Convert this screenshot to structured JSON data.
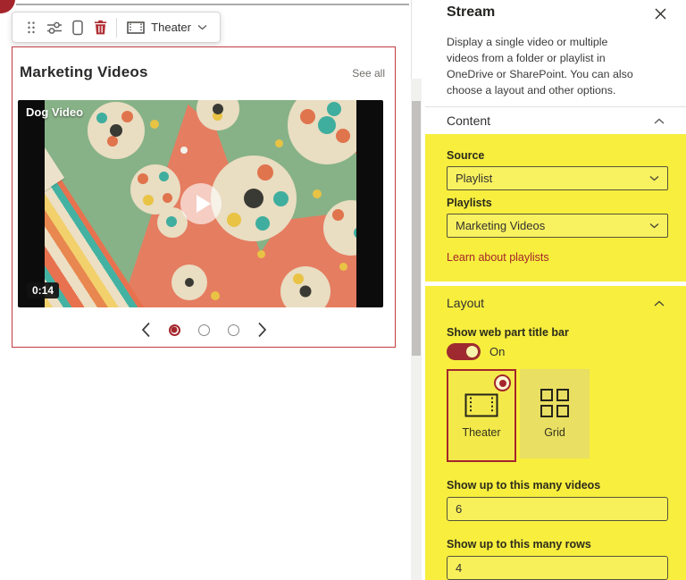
{
  "canvas": {
    "toolbar": {
      "layout_button_label": "Theater",
      "icons": [
        "drag-handle-icon",
        "edit-properties-icon",
        "duplicate-icon",
        "delete-icon",
        "theater-layout-icon",
        "chevron-down-icon"
      ]
    },
    "webpart": {
      "title": "Marketing Videos",
      "see_all": "See all",
      "video": {
        "title_overlay": "Dog Video",
        "duration": "0:14",
        "play_icon": "play-icon"
      },
      "carousel": {
        "dot_count": 3,
        "selected_index": 0,
        "prev_icon": "chevron-left-icon",
        "next_icon": "chevron-right-icon"
      }
    }
  },
  "panel": {
    "title": "Stream",
    "close_icon": "close-icon",
    "description": "Display a single video or multiple videos from a folder or playlist in OneDrive or SharePoint. You can also choose a layout and other options.",
    "content_section": {
      "header": "Content",
      "collapse_icon": "chevron-up-icon",
      "source_label": "Source",
      "source_value": "Playlist",
      "playlists_label": "Playlists",
      "playlists_value": "Marketing Videos",
      "learn_link": "Learn about playlists"
    },
    "layout_section": {
      "header": "Layout",
      "collapse_icon": "chevron-up-icon",
      "title_bar_label": "Show web part title bar",
      "toggle_state": "On",
      "options": [
        {
          "label": "Theater",
          "selected": true
        },
        {
          "label": "Grid",
          "selected": false
        }
      ],
      "max_videos_label": "Show up to this many videos",
      "max_videos_value": "6",
      "max_rows_label": "Show up to this many rows",
      "max_rows_value": "4"
    }
  },
  "colors": {
    "accent_red": "#a4262c",
    "webpart_border_red": "#c13b41",
    "highlight_yellow": "#f7ee3e",
    "text_primary": "#323130",
    "text_secondary": "#605e5c"
  }
}
